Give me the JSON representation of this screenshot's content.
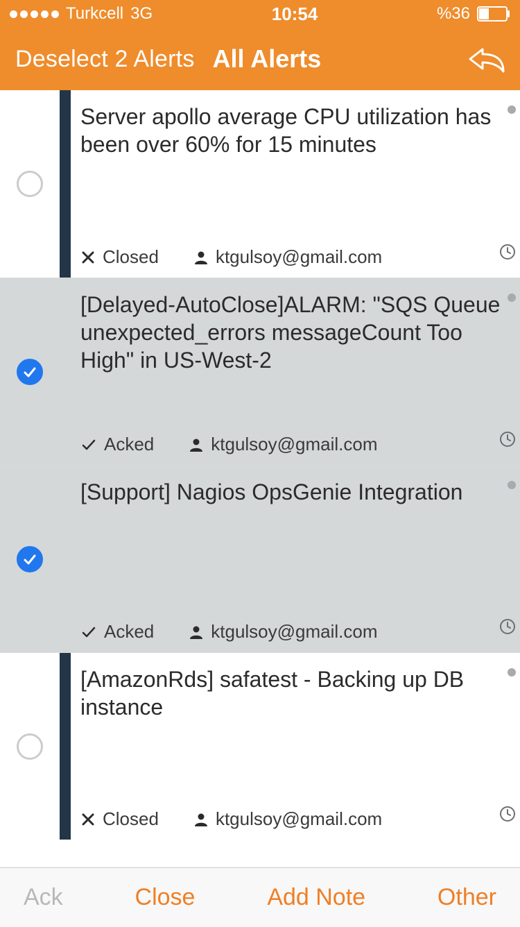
{
  "status_bar": {
    "carrier": "Turkcell",
    "network": "3G",
    "time": "10:54",
    "battery_text": "%36"
  },
  "nav": {
    "back_label": "Deselect 2 Alerts",
    "title": "All Alerts"
  },
  "alerts": [
    {
      "selected": false,
      "stripe": "closed",
      "title": "Server apollo average CPU utilization has been over 60% for 15 minutes",
      "status_icon": "x",
      "status_text": "Closed",
      "owner": "ktgulsoy@gmail.com"
    },
    {
      "selected": true,
      "stripe": "acked",
      "title": "[Delayed-AutoClose]ALARM: \"SQS Queue unexpected_errors messageCount Too High\" in US-West-2",
      "status_icon": "check",
      "status_text": "Acked",
      "owner": "ktgulsoy@gmail.com"
    },
    {
      "selected": true,
      "stripe": "acked",
      "title": "[Support] Nagios OpsGenie Integration",
      "status_icon": "check",
      "status_text": "Acked",
      "owner": "ktgulsoy@gmail.com"
    },
    {
      "selected": false,
      "stripe": "closed",
      "title": "[AmazonRds] safatest - Backing up DB instance",
      "status_icon": "x",
      "status_text": "Closed",
      "owner": "ktgulsoy@gmail.com"
    }
  ],
  "toolbar": {
    "ack": "Ack",
    "close": "Close",
    "add_note": "Add Note",
    "other": "Other"
  }
}
